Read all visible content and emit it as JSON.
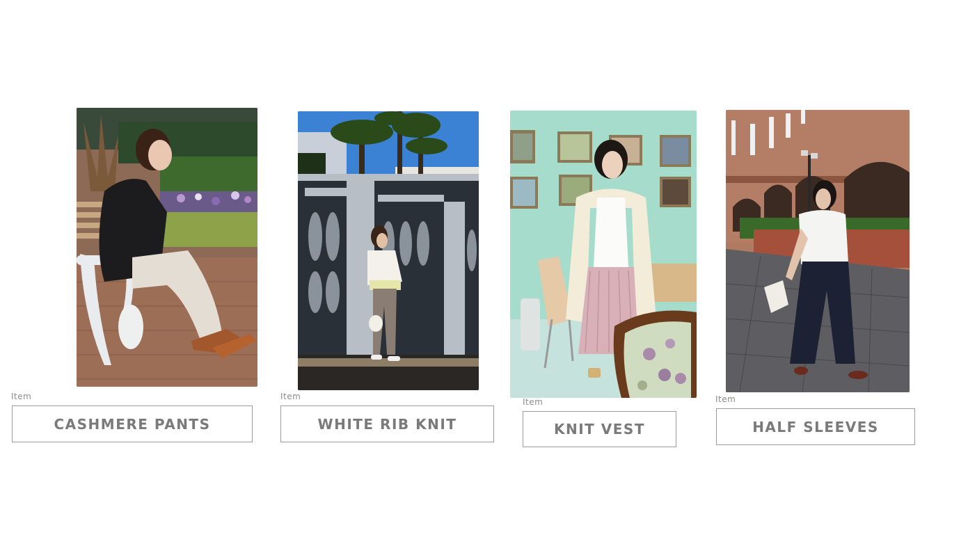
{
  "items": [
    {
      "category_label": "Item",
      "button_label": "CASHMERE PANTS",
      "photo_subject": "woman in black jacket and white pants seated on a park bench",
      "accent": "#3a2a22"
    },
    {
      "category_label": "Item",
      "button_label": "WHITE RIB KNIT",
      "photo_subject": "woman in white knit sweater leaning on a stone fence under palm trees",
      "accent": "#f0efe8"
    },
    {
      "category_label": "Item",
      "button_label": "KNIT VEST",
      "photo_subject": "woman in long cream coat and pink pleated skirt in a mint green room",
      "accent": "#9fd6c6"
    },
    {
      "category_label": "Item",
      "button_label": "HALF SLEEVES",
      "photo_subject": "woman in white half-sleeve top and navy wide pants on a brick plaza",
      "accent": "#a1604a"
    }
  ],
  "colors": {
    "background": "#ffffff",
    "button_text": "#7a7a7a",
    "button_border": "#9a9a9a",
    "label_text": "#8a8a8a"
  }
}
